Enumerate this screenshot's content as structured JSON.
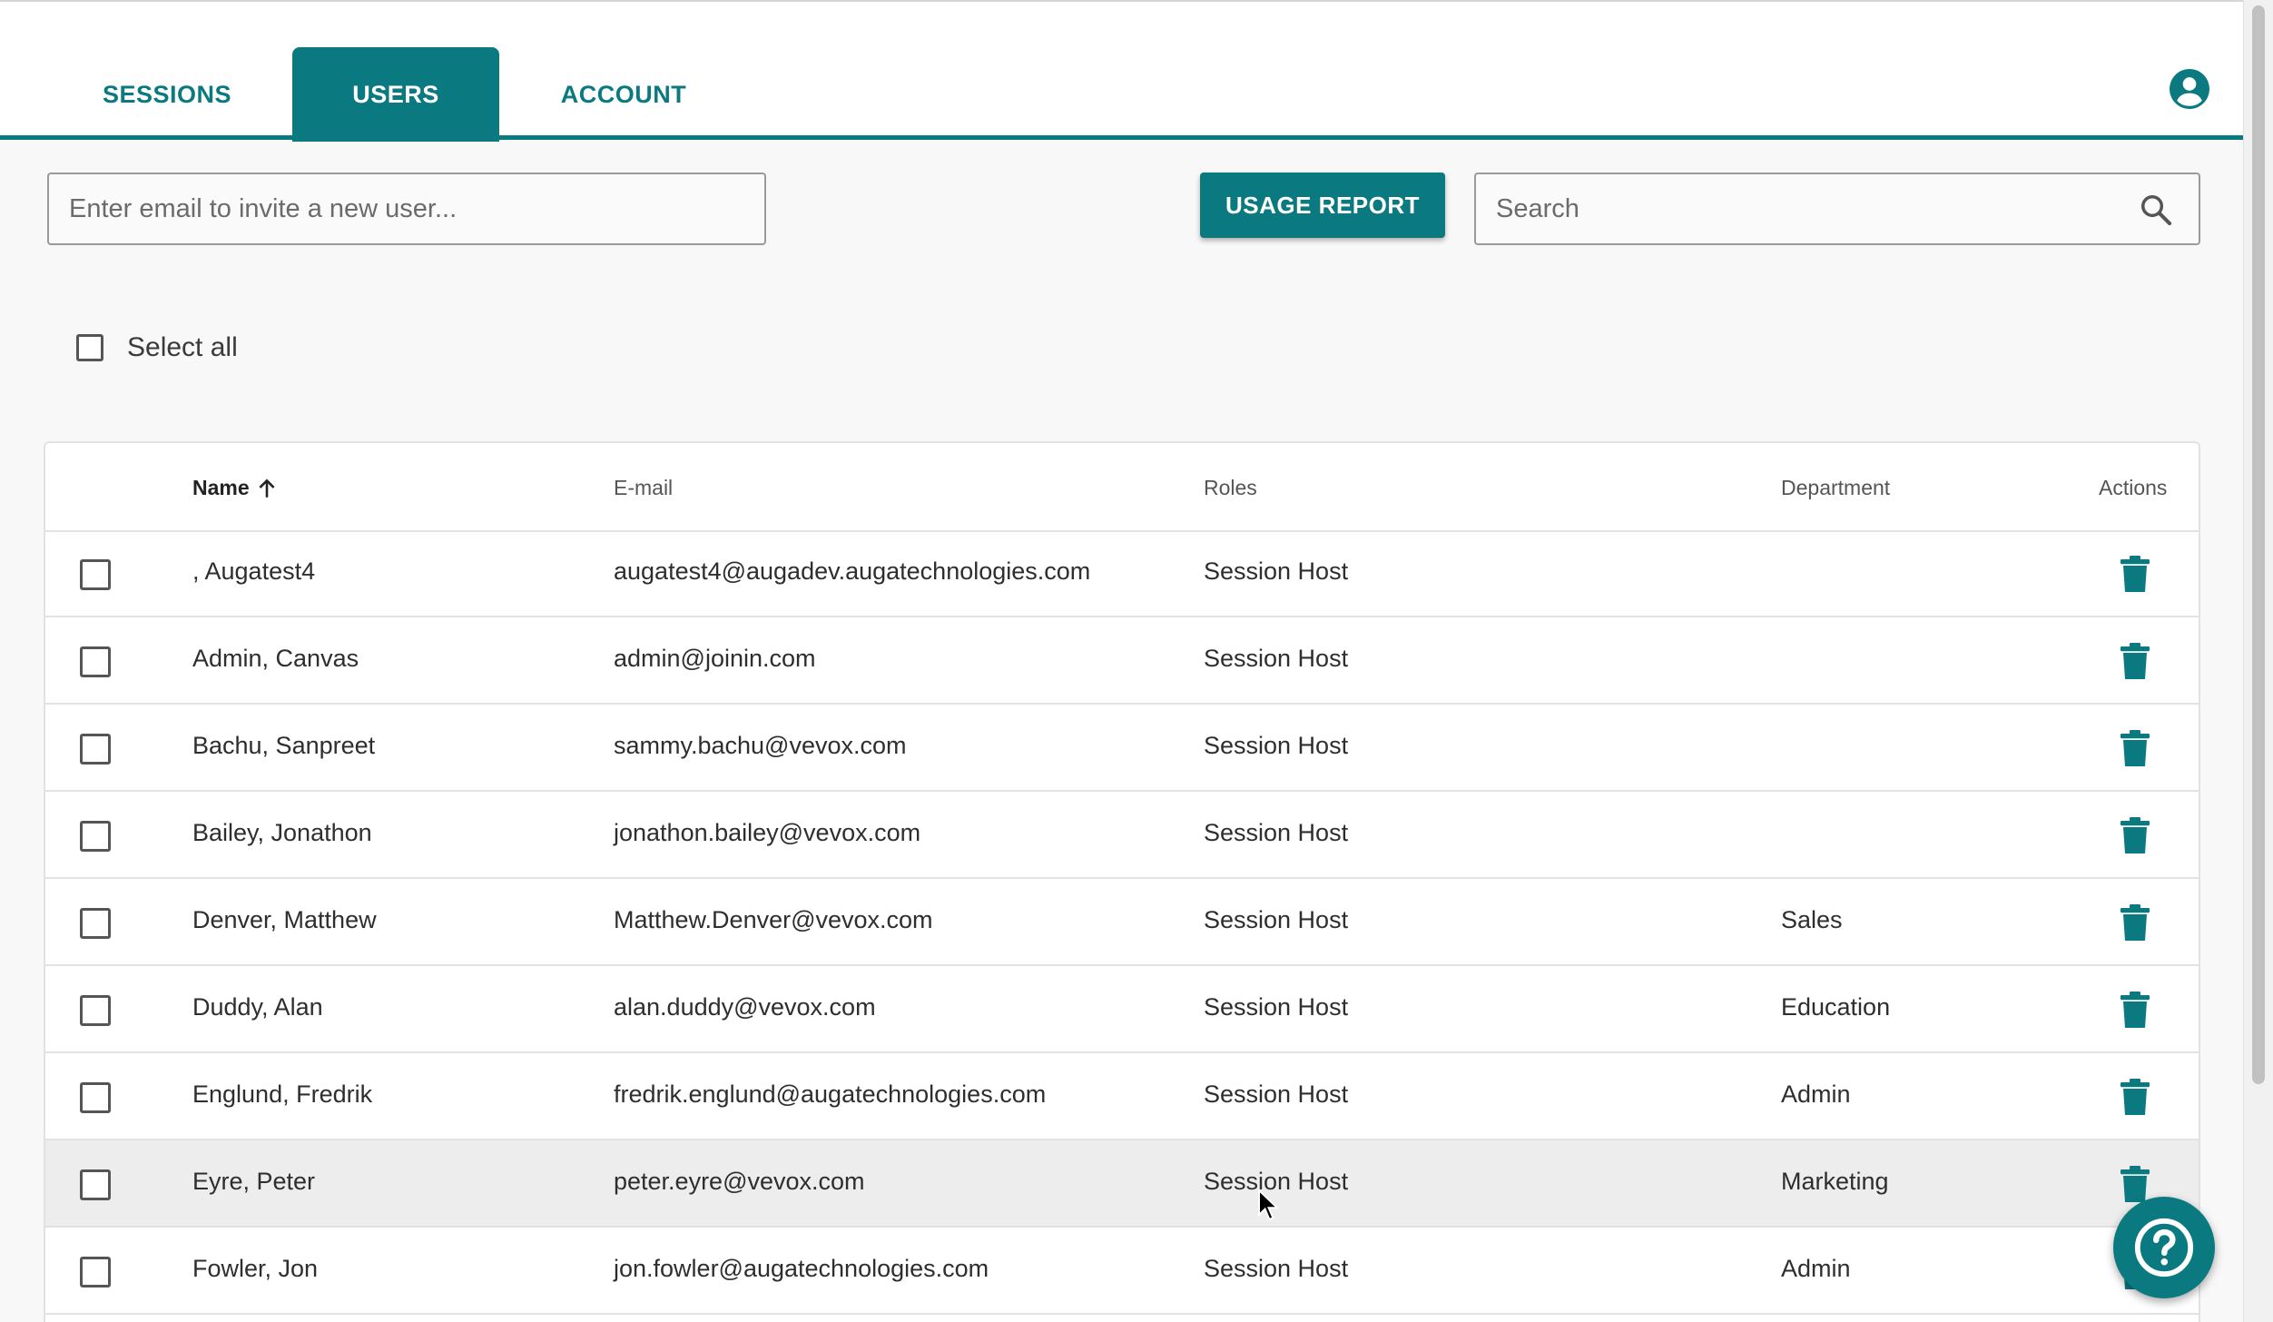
{
  "nav": {
    "tabs": [
      {
        "label": "SESSIONS",
        "active": false
      },
      {
        "label": "USERS",
        "active": true
      },
      {
        "label": "ACCOUNT",
        "active": false
      }
    ],
    "account_icon": "account-circle-icon"
  },
  "toolbar": {
    "invite_placeholder": "Enter email to invite a new user...",
    "usage_report_label": "USAGE REPORT",
    "search_placeholder": "Search"
  },
  "select_all": {
    "label": "Select all",
    "checked": false
  },
  "table": {
    "headers": {
      "name": "Name",
      "email": "E-mail",
      "roles": "Roles",
      "department": "Department",
      "actions": "Actions"
    },
    "sort": {
      "column": "name",
      "direction": "ascending"
    },
    "rows": [
      {
        "name": ", Augatest4",
        "email": "augatest4@augadev.augatechnologies.com",
        "role": "Session Host",
        "department": ""
      },
      {
        "name": "Admin, Canvas",
        "email": "admin@joinin.com",
        "role": "Session Host",
        "department": ""
      },
      {
        "name": "Bachu, Sanpreet",
        "email": "sammy.bachu@vevox.com",
        "role": "Session Host",
        "department": ""
      },
      {
        "name": "Bailey, Jonathon",
        "email": "jonathon.bailey@vevox.com",
        "role": "Session Host",
        "department": ""
      },
      {
        "name": "Denver, Matthew",
        "email": "Matthew.Denver@vevox.com",
        "role": "Session Host",
        "department": "Sales"
      },
      {
        "name": "Duddy, Alan",
        "email": "alan.duddy@vevox.com",
        "role": "Session Host",
        "department": "Education"
      },
      {
        "name": "Englund, Fredrik",
        "email": "fredrik.englund@augatechnologies.com",
        "role": "Session Host",
        "department": "Admin"
      },
      {
        "name": "Eyre, Peter",
        "email": "peter.eyre@vevox.com",
        "role": "Session Host",
        "department": "Marketing"
      },
      {
        "name": "Fowler, Jon",
        "email": "jon.fowler@augatechnologies.com",
        "role": "Session Host",
        "department": "Admin"
      }
    ]
  },
  "colors": {
    "accent": "#0b7a80",
    "background": "#f8f8f8",
    "row_hover": "#ededed"
  },
  "help_icon": "help-circle-icon"
}
